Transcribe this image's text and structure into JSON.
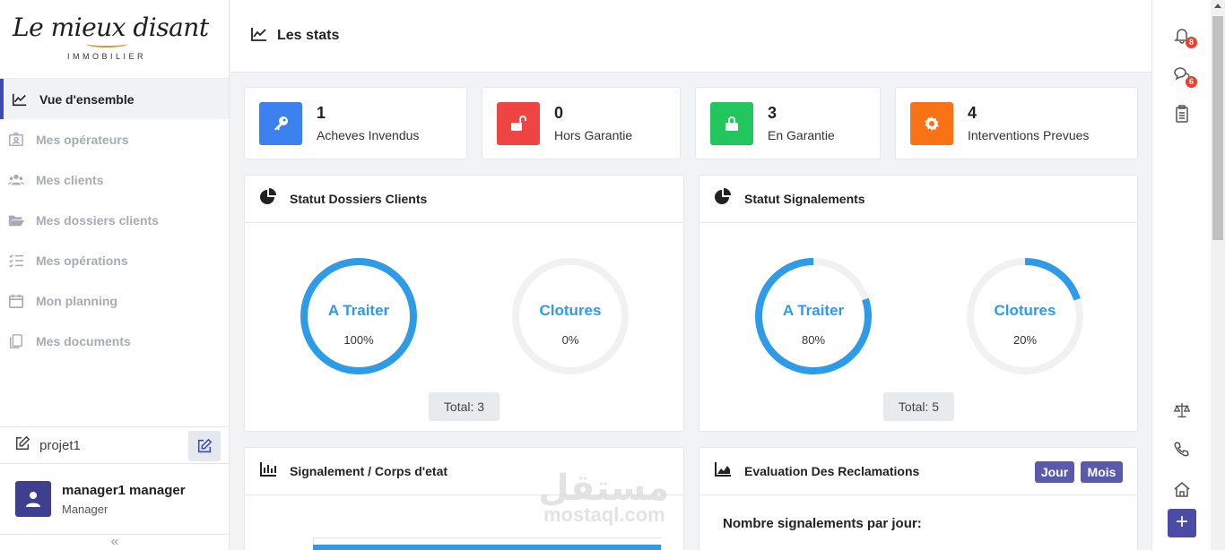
{
  "brand": {
    "script": "Le mieux disant",
    "sub": "IMMOBILIER"
  },
  "sidebar": {
    "items": [
      {
        "label": "Vue d'ensemble",
        "icon": "line-chart-icon",
        "active": true
      },
      {
        "label": "Mes opérateurs",
        "icon": "id-badge-icon"
      },
      {
        "label": "Mes clients",
        "icon": "users-icon"
      },
      {
        "label": "Mes dossiers clients",
        "icon": "folder-open-icon"
      },
      {
        "label": "Mes opérations",
        "icon": "checklist-icon"
      },
      {
        "label": "Mon planning",
        "icon": "calendar-icon"
      },
      {
        "label": "Mes documents",
        "icon": "documents-icon"
      }
    ],
    "project": "projet1",
    "user": {
      "name": "manager1 manager",
      "role": "Manager"
    },
    "collapse": "«"
  },
  "header": {
    "title": "Les stats"
  },
  "stats": [
    {
      "value": "1",
      "label": "Acheves Invendus",
      "color": "#3b82f0",
      "icon": "key-icon"
    },
    {
      "value": "0",
      "label": "Hors Garantie",
      "color": "#ef4444",
      "icon": "lock-open-icon"
    },
    {
      "value": "3",
      "label": "En Garantie",
      "color": "#22c55e",
      "icon": "lock-icon"
    },
    {
      "value": "4",
      "label": "Interventions Prevues",
      "color": "#f97316",
      "icon": "gear-icon"
    }
  ],
  "panels": {
    "dossiers": {
      "title": "Statut Dossiers Clients",
      "rings": [
        {
          "label": "A Traiter",
          "pct_text": "100%",
          "fraction": 1.0
        },
        {
          "label": "Clotures",
          "pct_text": "0%",
          "fraction": 0.0
        }
      ],
      "total": "Total: 3"
    },
    "signalements": {
      "title": "Statut Signalements",
      "rings": [
        {
          "label": "A Traiter",
          "pct_text": "80%",
          "fraction": 0.8
        },
        {
          "label": "Clotures",
          "pct_text": "20%",
          "fraction": 0.2
        }
      ],
      "total": "Total: 5"
    },
    "corps": {
      "title": "Signalement / Corps d'etat"
    },
    "reclamations": {
      "title": "Evaluation Des Reclamations",
      "buttons": [
        "Jour",
        "Mois"
      ],
      "subtitle": "Nombre signalements par jour:"
    }
  },
  "rail": {
    "notifications_count": "8",
    "messages_count": "6",
    "add_label": "+"
  },
  "watermark": {
    "ar": "مستقل",
    "en": "mostaql.com"
  },
  "colors": {
    "accent": "#2d9be8",
    "track": "#f1f1f1",
    "primary": "#4c4ca6"
  }
}
